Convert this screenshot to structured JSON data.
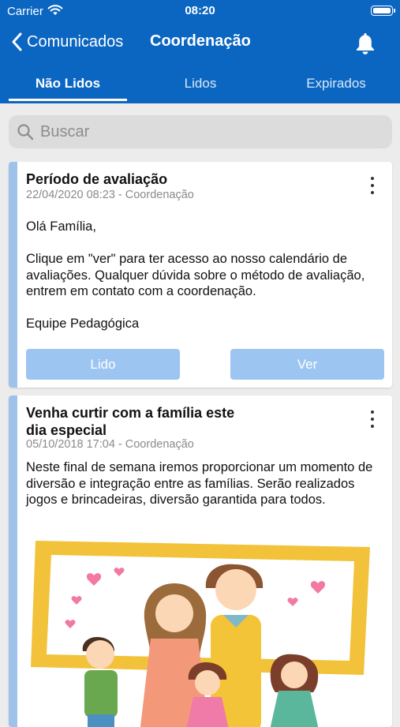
{
  "status": {
    "carrier": "Carrier",
    "time": "08:20"
  },
  "nav": {
    "back_label": "Comunicados",
    "title": "Coordenação"
  },
  "tabs": [
    {
      "label": "Não Lidos",
      "active": true
    },
    {
      "label": "Lidos",
      "active": false
    },
    {
      "label": "Expirados",
      "active": false
    }
  ],
  "search": {
    "placeholder": "Buscar",
    "value": ""
  },
  "messages": [
    {
      "title": "Período de avaliação",
      "meta": "22/04/2020 08:23 - Coordenação",
      "body": "Olá Família,\n\nClique em \"ver\" para ter acesso ao nosso calendário de avaliações. Qualquer dúvida sobre o método de avaliação, entrem em contato com a coordenação.\n\nEquipe Pedagógica",
      "button_read": "Lido",
      "button_view": "Ver"
    },
    {
      "title_line1": "Venha curtir com a família este",
      "title_line2": "dia especial",
      "meta": "05/10/2018 17:04 - Coordenação",
      "body": "Neste final de semana iremos proporcionar um momento de diversão e integração entre as famílias. Serão realizados jogos e brincadeiras, diversão garantida para todos.",
      "image": "family-illustration"
    }
  ],
  "colors": {
    "header": "#0b66c2",
    "accent_bar": "#9ec2ea",
    "button": "#9dc5f1",
    "frame": "#f2c23a"
  }
}
